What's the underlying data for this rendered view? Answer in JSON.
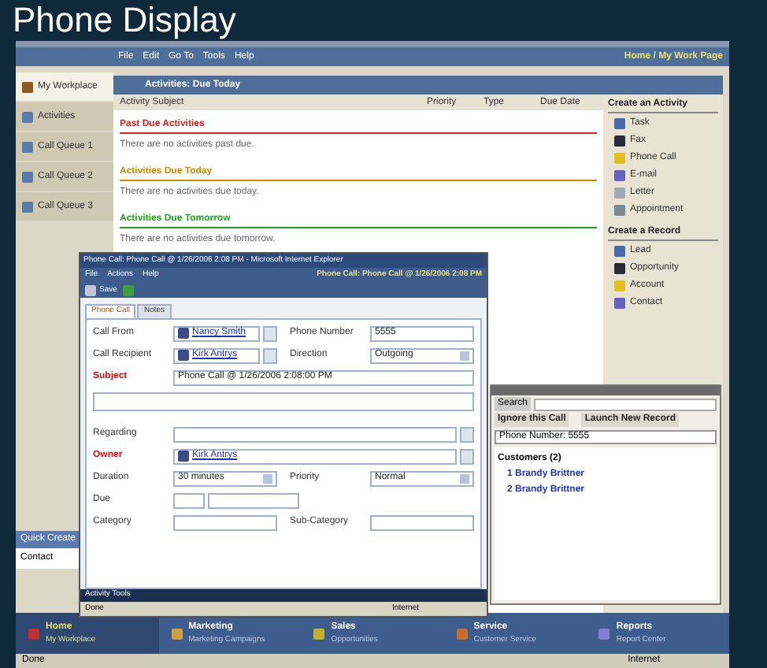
{
  "heading": "Phone Display",
  "menu": [
    "File",
    "Edit",
    "Go To",
    "Tools",
    "Help"
  ],
  "top_link": "Home / My Work Page",
  "sidebar": {
    "items": [
      {
        "label": "My Workplace",
        "selected": true
      },
      {
        "label": "Activities",
        "selected": false
      },
      {
        "label": "Call Queue 1",
        "selected": false
      },
      {
        "label": "Call Queue 2",
        "selected": false
      },
      {
        "label": "Call Queue 3",
        "selected": false
      }
    ],
    "quick_create": "Quick Create",
    "quick_item": "Contact"
  },
  "activities": {
    "title": "Activities: Due Today",
    "columns": [
      "Activity Subject",
      "Priority",
      "Type",
      "Due Date"
    ],
    "groups": [
      {
        "label": "Past Due Activities",
        "color": "#e02020",
        "empty": "There are no activities past due."
      },
      {
        "label": "Activities Due Today",
        "color": "#d08a00",
        "empty": "There are no activities due today."
      },
      {
        "label": "Activities Due Tomorrow",
        "color": "#20a020",
        "empty": "There are no activities due tomorrow."
      }
    ]
  },
  "actions": [
    {
      "title": "Create an Activity",
      "items": [
        "Task",
        "Fax",
        "Phone Call",
        "E-mail",
        "Letter",
        "Appointment"
      ]
    },
    {
      "title": "Create a Record",
      "items": [
        "Lead",
        "Opportunity",
        "Account",
        "Contact"
      ]
    }
  ],
  "phone_window": {
    "title": "Phone Call: Phone Call @ 1/26/2006 2:08 PM - Microsoft Internet Explorer",
    "menu": [
      "File",
      "Actions",
      "Help"
    ],
    "header": "Phone Call: Phone Call @ 1/26/2006 2:08 PM",
    "save": "Save",
    "tabs": [
      {
        "label": "Phone Call",
        "selected": true
      },
      {
        "label": "Notes",
        "selected": false
      }
    ],
    "rows": [
      [
        {
          "label": "Call From",
          "kind": "lookup",
          "value": "Nancy Smith",
          "required": false
        },
        {
          "label": "Phone Number",
          "kind": "text",
          "value": "5555",
          "required": false
        }
      ],
      [
        {
          "label": "Call Recipient",
          "kind": "lookup",
          "value": "Kirk Antrys",
          "required": false
        },
        {
          "label": "Direction",
          "kind": "select",
          "value": "Outgoing",
          "required": false
        }
      ],
      [
        {
          "label": "Subject",
          "kind": "text",
          "value": "Phone Call @ 1/26/2006 2:08:00 PM",
          "required": true
        }
      ],
      [
        {
          "kind": "memo"
        }
      ],
      [
        {
          "label": "Regarding",
          "kind": "lookup",
          "required": false
        }
      ],
      [
        {
          "label": "Owner",
          "kind": "lookup",
          "value": "Kirk Antrys",
          "required": true
        }
      ],
      [
        {
          "label": "Duration",
          "kind": "select",
          "value": "30 minutes",
          "required": false
        },
        {
          "label": "Priority",
          "kind": "select",
          "value": "Normal",
          "required": false
        }
      ],
      [
        {
          "label": "Due",
          "kind": "date",
          "required": false
        }
      ],
      [
        {
          "label": "Category",
          "kind": "text",
          "required": false
        },
        {
          "label": "Sub-Category",
          "kind": "text",
          "required": false
        }
      ]
    ],
    "footer_title": "Activity Tools",
    "footer_left": "Done",
    "footer_right": "Internet"
  },
  "popup": {
    "search": "Search",
    "buttons": [
      "Ignore this Call",
      "Launch New Record"
    ],
    "phone": "Phone Number: 5555",
    "group": "Customers (2)",
    "items": [
      "1 Brandy Brittner",
      "2 Brandy Brittner"
    ]
  },
  "nav": [
    {
      "label": "Home",
      "sub": "My Workplace",
      "selected": true
    },
    {
      "label": "Marketing",
      "sub": "Marketing Campaigns",
      "selected": false
    },
    {
      "label": "Sales",
      "sub": "Opportunities",
      "selected": false
    },
    {
      "label": "Service",
      "sub": "Customer Service",
      "selected": false
    },
    {
      "label": "Reports",
      "sub": "Report Center",
      "selected": false
    }
  ],
  "status": {
    "left": "Done",
    "right": "Internet"
  }
}
